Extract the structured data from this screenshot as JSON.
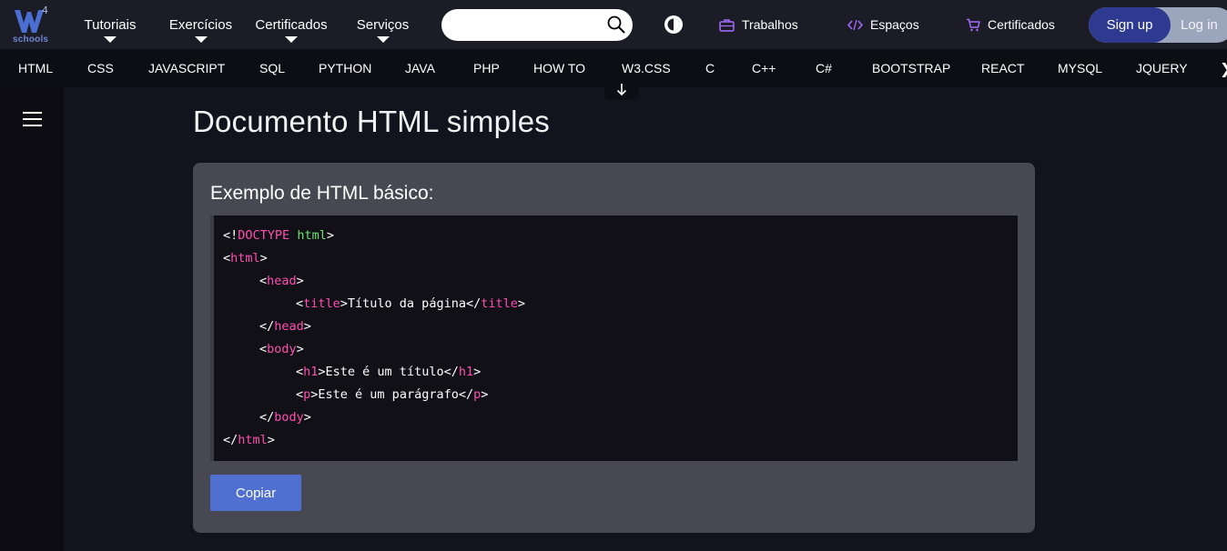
{
  "brand": {
    "superscript": "4",
    "wordmark": "schools"
  },
  "nav": [
    {
      "label": "Tutoriais"
    },
    {
      "label": "Exercícios"
    },
    {
      "label": "Certificados"
    },
    {
      "label": "Serviços"
    }
  ],
  "search": {
    "placeholder": "",
    "value": ""
  },
  "links": {
    "jobs": "Trabalhos",
    "spaces": "Espaços",
    "certificates": "Certificados"
  },
  "auth": {
    "signup": "Sign up",
    "login": "Log in"
  },
  "subjects": [
    "HTML",
    "CSS",
    "JAVASCRIPT",
    "SQL",
    "PYTHON",
    "JAVA",
    "PHP",
    "HOW TO",
    "W3.CSS",
    "C",
    "C++",
    "C#",
    "BOOTSTRAP",
    "REACT",
    "MYSQL",
    "JQUERY"
  ],
  "subjects_more": "❯",
  "main": {
    "title": "Documento HTML simples",
    "example_title": "Exemplo de HTML básico:",
    "code": {
      "l1_a": "<!",
      "l1_b": "DOCTYPE",
      "l1_c": " ",
      "l1_d": "html",
      "l1_e": ">",
      "l2_a": "<",
      "l2_b": "html",
      "l2_c": ">",
      "l3_a": "<",
      "l3_b": "head",
      "l3_c": ">",
      "l4_a": "<",
      "l4_b": "title",
      "l4_c": ">Título da página</",
      "l4_d": "title",
      "l4_e": ">",
      "l5_a": "</",
      "l5_b": "head",
      "l5_c": ">",
      "l6_a": "<",
      "l6_b": "body",
      "l6_c": ">",
      "l7_a": "<",
      "l7_b": "h1",
      "l7_c": ">Este é um título</",
      "l7_d": "h1",
      "l7_e": ">",
      "l8_a": "<",
      "l8_b": "p",
      "l8_c": ">Este é um parágrafo</",
      "l8_d": "p",
      "l8_e": ">",
      "l9_a": "</",
      "l9_b": "body",
      "l9_c": ">",
      "l10_a": "</",
      "l10_b": "html",
      "l10_c": ">"
    },
    "copy_button": "Copiar"
  },
  "colors": {
    "topbar": "#1c1c26",
    "page_bg": "#13131d",
    "example_bg": "#484853",
    "code_bg": "#101016",
    "tag": "#ff4fb0",
    "attr": "#6ee36e",
    "signup_bg": "#2d3a8f",
    "copy_button": "#4f6fd1",
    "brand": "#6f86d6"
  },
  "icons": {
    "search": "search-icon",
    "theme": "theme-toggle-icon",
    "jobs": "briefcase-icon",
    "spaces": "code-icon",
    "certificates": "cart-icon",
    "menu": "hamburger-icon",
    "down_arrow": "arrow-down-icon"
  }
}
